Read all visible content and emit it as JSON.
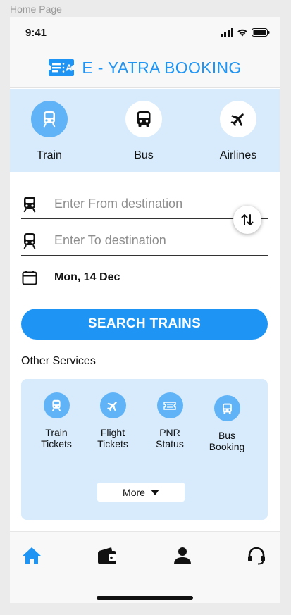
{
  "canvas": {
    "label": "Home Page"
  },
  "status_bar": {
    "time": "9:41"
  },
  "header": {
    "title": "E - YATRA BOOKING"
  },
  "modes": [
    {
      "label": "Train",
      "icon": "train-icon",
      "active": true
    },
    {
      "label": "Bus",
      "icon": "bus-icon",
      "active": false
    },
    {
      "label": "Airlines",
      "icon": "airplane-icon",
      "active": false
    }
  ],
  "form": {
    "from_placeholder": "Enter From destination",
    "from_value": "",
    "to_placeholder": "Enter To destination",
    "to_value": "",
    "date": "Mon, 14 Dec",
    "swap_icon": "swap-icon"
  },
  "search_button": {
    "label": "SEARCH TRAINS"
  },
  "other_services": {
    "title": "Other Services",
    "items": [
      {
        "line1": "Train",
        "line2": "Tickets",
        "icon": "train-icon"
      },
      {
        "line1": "Flight",
        "line2": "Tickets",
        "icon": "airplane-icon"
      },
      {
        "line1": "PNR",
        "line2": "Status",
        "icon": "ticket-icon"
      },
      {
        "line1": "Bus",
        "line2": "Booking",
        "icon": "bus-icon"
      }
    ],
    "more_label": "More"
  },
  "bottom_nav": [
    {
      "icon": "home-icon",
      "active": true
    },
    {
      "icon": "wallet-icon",
      "active": false
    },
    {
      "icon": "profile-icon",
      "active": false
    },
    {
      "icon": "headset-icon",
      "active": false
    }
  ],
  "colors": {
    "accent": "#1e95f5",
    "accent_light": "#5fb3f6",
    "panel_background": "#d7ebfc",
    "text": "#111111"
  }
}
